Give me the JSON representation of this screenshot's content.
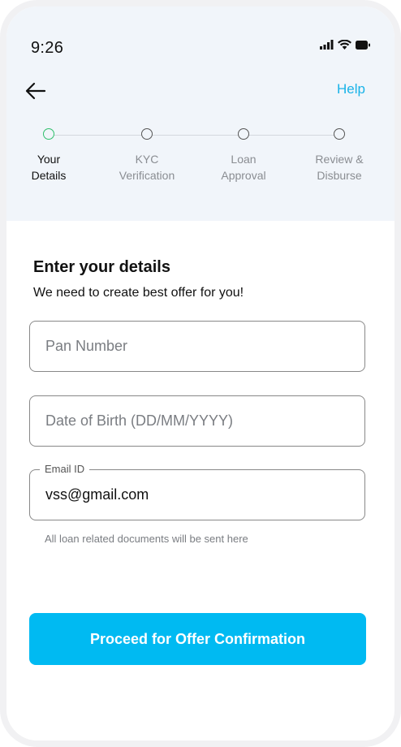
{
  "status_bar": {
    "time": "9:26",
    "icons": [
      "signal-icon",
      "wifi-icon",
      "battery-icon"
    ]
  },
  "header": {
    "back_icon": "arrow-left-icon",
    "help_label": "Help"
  },
  "stepper": {
    "active_color": "#2fbf6c",
    "steps": [
      {
        "label": "Your\nDetails",
        "active": true
      },
      {
        "label": "KYC\nVerification",
        "active": false
      },
      {
        "label": "Loan\nApproval",
        "active": false
      },
      {
        "label": "Review &\nDisburse",
        "active": false
      }
    ]
  },
  "form": {
    "title": "Enter your details",
    "subtitle": "We need to create best offer for you!",
    "pan": {
      "placeholder": "Pan Number",
      "value": ""
    },
    "dob": {
      "placeholder": "Date of Birth (DD/MM/YYYY)",
      "value": ""
    },
    "email": {
      "label": "Email ID",
      "value": "vss@gmail.com",
      "helper": "All loan related documents will be sent here"
    }
  },
  "cta": {
    "label": "Proceed for Offer Confirmation",
    "color": "#00baf2"
  },
  "colors": {
    "accent": "#1ab3e8",
    "header_bg": "#f1f5fa"
  }
}
